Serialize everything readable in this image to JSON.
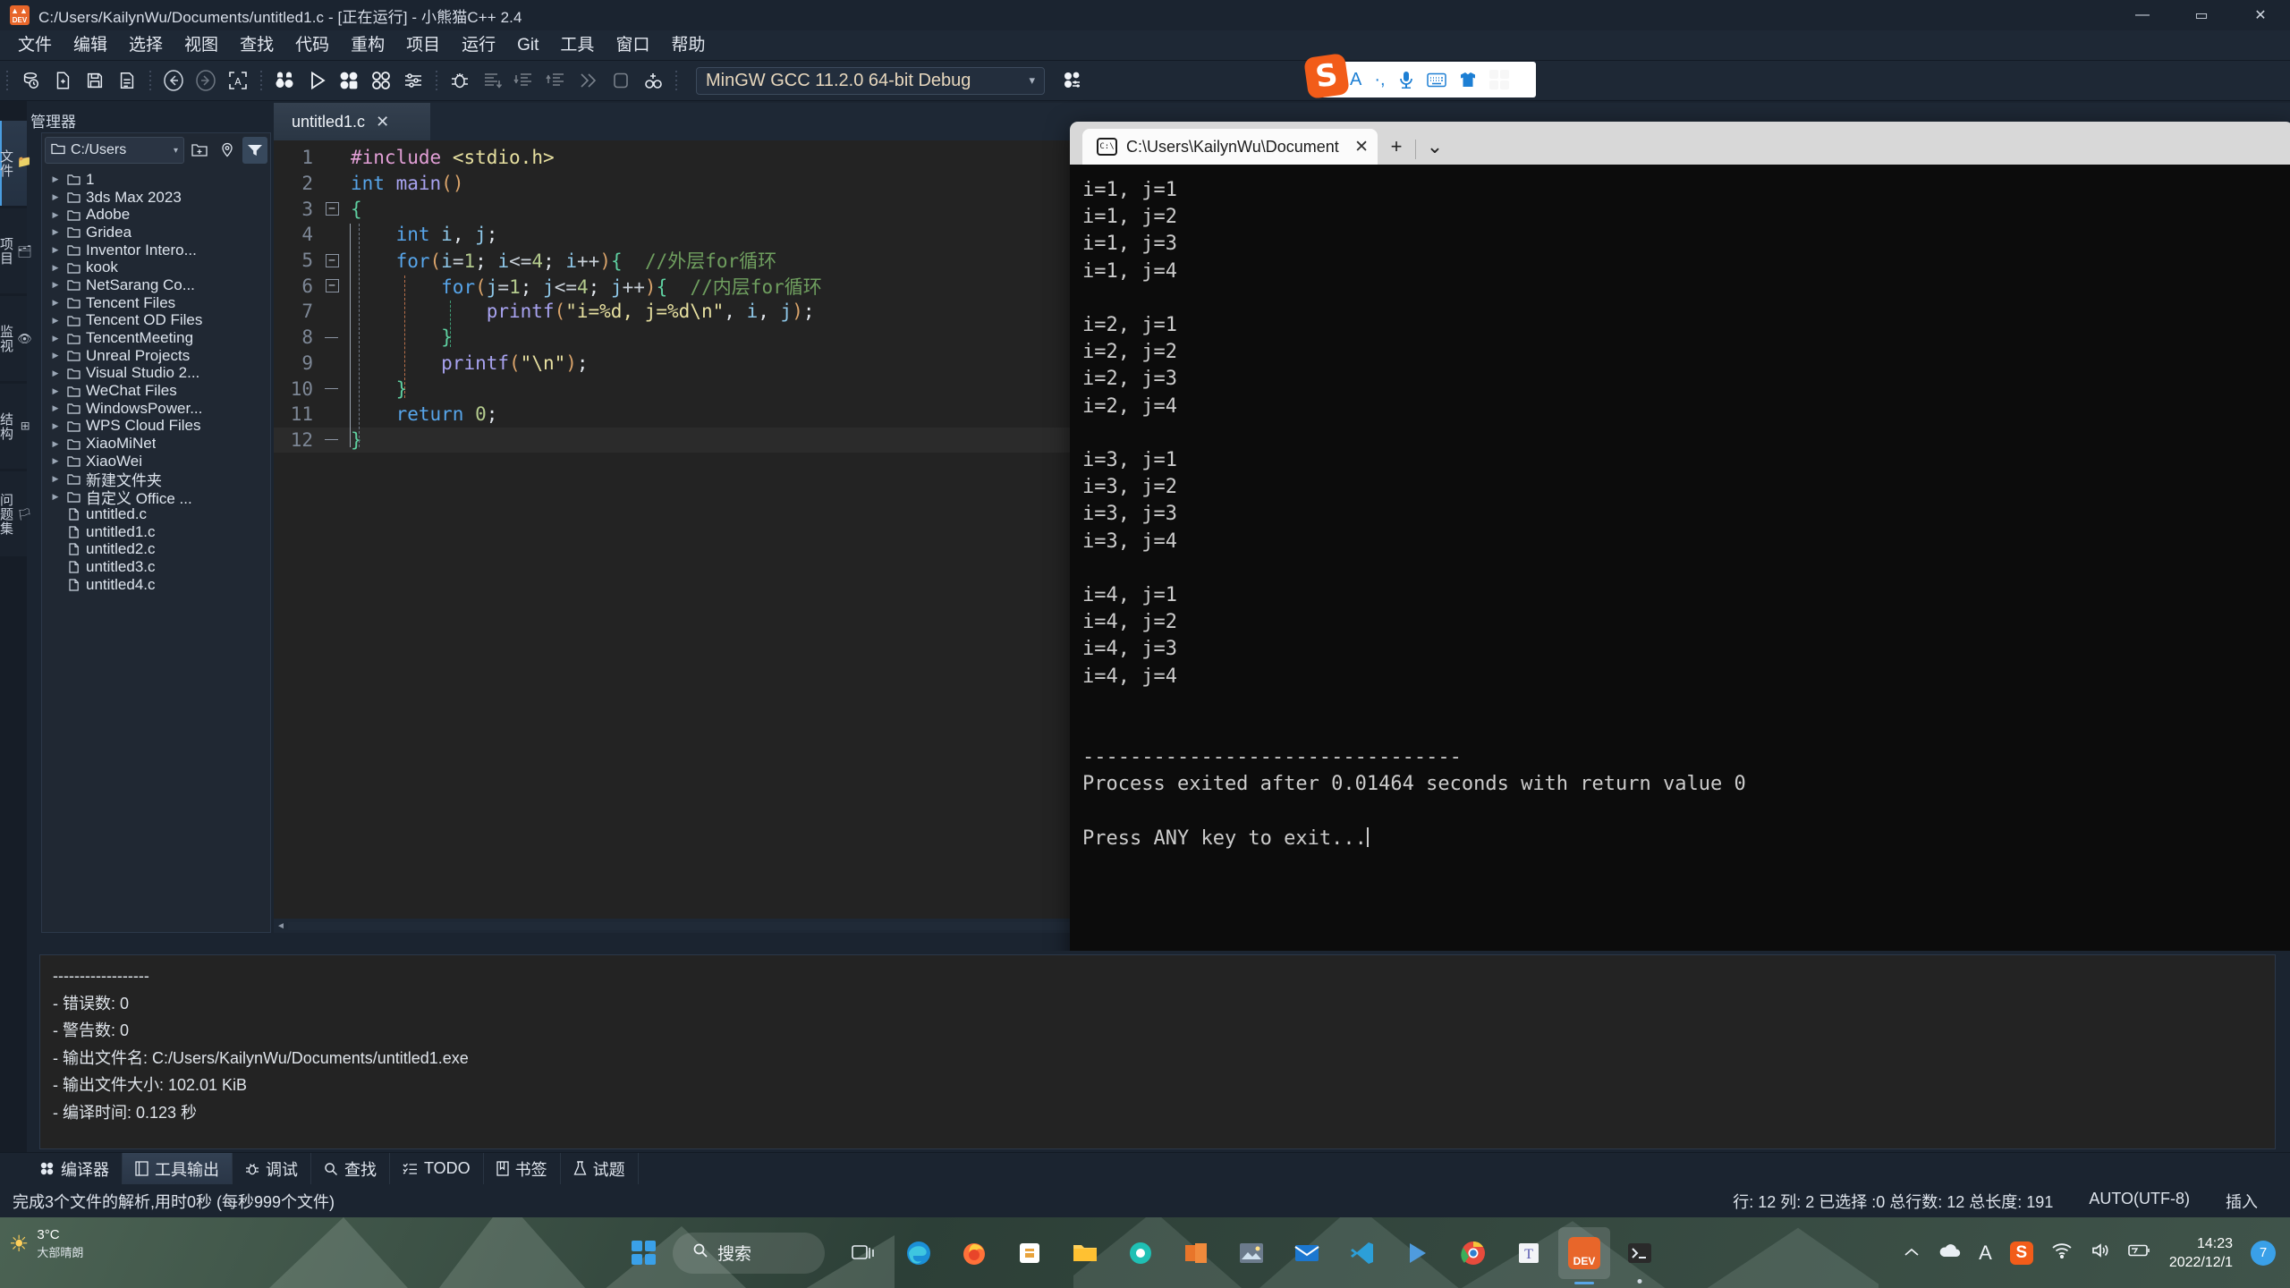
{
  "window": {
    "title": "C:/Users/KailynWu/Documents/untitled1.c - [正在运行] - 小熊猫C++ 2.4",
    "app_icon_label": "DEV",
    "minimize": "—",
    "maximize": "▭",
    "close": "✕"
  },
  "menubar": {
    "items": [
      "文件",
      "编辑",
      "选择",
      "视图",
      "查找",
      "代码",
      "重构",
      "项目",
      "运行",
      "Git",
      "工具",
      "窗口",
      "帮助"
    ]
  },
  "toolbar": {
    "compiler_set": "MinGW GCC 11.2.0 64-bit Debug",
    "caret": "▾",
    "icons": [
      "project-icon",
      "new-file-icon",
      "save-icon",
      "save-as-icon",
      "back-icon",
      "forward-icon",
      "select-all-icon",
      "compile-icon",
      "run-icon",
      "compile-run-icon",
      "rebuild-icon",
      "options-icon",
      "debug-icon",
      "step-over-icon",
      "step-into-icon",
      "step-out-icon",
      "continue-icon",
      "stop-icon",
      "add-watch-icon",
      "compiler-options-icon"
    ]
  },
  "ime": {
    "logo": "S",
    "buttons": [
      "A",
      "·,",
      "mic-icon",
      "keyboard-icon",
      "skin-icon",
      "apps-icon"
    ]
  },
  "vertical_tabs": [
    {
      "label": "文件",
      "icon": "📁",
      "active": true
    },
    {
      "label": "项目",
      "icon": "🗂",
      "active": false
    },
    {
      "label": "监视",
      "icon": "👁",
      "active": false
    },
    {
      "label": "结构",
      "icon": "⊞",
      "active": false
    },
    {
      "label": "问题集",
      "icon": "🏳",
      "active": false
    }
  ],
  "explorer": {
    "title": "管理器",
    "path": "C:/Users",
    "path_caret": "▾",
    "buttons": [
      "new-folder-icon",
      "locate-icon",
      "filter-icon"
    ],
    "tree": [
      {
        "label": "1",
        "type": "folder"
      },
      {
        "label": "3ds Max 2023",
        "type": "folder"
      },
      {
        "label": "Adobe",
        "type": "folder"
      },
      {
        "label": "Gridea",
        "type": "folder"
      },
      {
        "label": "Inventor Intero...",
        "type": "folder"
      },
      {
        "label": "kook",
        "type": "folder"
      },
      {
        "label": "NetSarang Co...",
        "type": "folder"
      },
      {
        "label": "Tencent Files",
        "type": "folder"
      },
      {
        "label": "Tencent OD Files",
        "type": "folder"
      },
      {
        "label": "TencentMeeting",
        "type": "folder"
      },
      {
        "label": "Unreal Projects",
        "type": "folder"
      },
      {
        "label": "Visual Studio 2...",
        "type": "folder"
      },
      {
        "label": "WeChat Files",
        "type": "folder"
      },
      {
        "label": "WindowsPower...",
        "type": "folder"
      },
      {
        "label": "WPS Cloud Files",
        "type": "folder"
      },
      {
        "label": "XiaoMiNet",
        "type": "folder"
      },
      {
        "label": "XiaoWei",
        "type": "folder"
      },
      {
        "label": "新建文件夹",
        "type": "folder"
      },
      {
        "label": "自定义 Office ...",
        "type": "folder"
      },
      {
        "label": "untitled.c",
        "type": "file"
      },
      {
        "label": "untitled1.c",
        "type": "file"
      },
      {
        "label": "untitled2.c",
        "type": "file"
      },
      {
        "label": "untitled3.c",
        "type": "file"
      },
      {
        "label": "untitled4.c",
        "type": "file"
      }
    ]
  },
  "editor": {
    "tab_label": "untitled1.c",
    "tab_close": "✕",
    "lines": [
      {
        "n": "1",
        "fold": "",
        "text": "#include <stdio.h>"
      },
      {
        "n": "2",
        "fold": "",
        "text": "int main()"
      },
      {
        "n": "3",
        "fold": "minus",
        "text": "{"
      },
      {
        "n": "4",
        "fold": "",
        "text": "    int i, j;"
      },
      {
        "n": "5",
        "fold": "minus",
        "text": "    for(i=1; i<=4; i++){  //外层for循环"
      },
      {
        "n": "6",
        "fold": "minus",
        "text": "        for(j=1; j<=4; j++){  //内层for循环"
      },
      {
        "n": "7",
        "fold": "",
        "text": "            printf(\"i=%d, j=%d\\n\", i, j);"
      },
      {
        "n": "8",
        "fold": "end",
        "text": "        }"
      },
      {
        "n": "9",
        "fold": "",
        "text": "        printf(\"\\n\");"
      },
      {
        "n": "10",
        "fold": "end",
        "text": "    }"
      },
      {
        "n": "11",
        "fold": "",
        "text": "    return 0;"
      },
      {
        "n": "12",
        "fold": "end",
        "text": "}"
      }
    ],
    "scroll_left": "◄",
    "scroll_right": "►"
  },
  "terminal": {
    "tab_title": "C:\\Users\\KailynWu\\Document",
    "tab_icon": "C:\\",
    "tab_close": "✕",
    "new_tab": "+",
    "dropdown": "⌄",
    "output": "i=1, j=1\ni=1, j=2\ni=1, j=3\ni=1, j=4\n\ni=2, j=1\ni=2, j=2\ni=2, j=3\ni=2, j=4\n\ni=3, j=1\ni=3, j=2\ni=3, j=3\ni=3, j=4\n\ni=4, j=1\ni=4, j=2\ni=4, j=3\ni=4, j=4\n\n\n--------------------------------\nProcess exited after 0.01464 seconds with return value 0\n\nPress ANY key to exit..."
  },
  "compiler_output": {
    "text": "------------------\n- 错误数: 0\n- 警告数: 0\n- 输出文件名: C:/Users/KailynWu/Documents/untitled1.exe\n- 输出文件大小: 102.01 KiB\n- 编译时间: 0.123 秒"
  },
  "bottom_tabs": {
    "rotated_label": "调试",
    "items": [
      {
        "label": "编译器",
        "icon": "compiler-icon",
        "active": false
      },
      {
        "label": "工具输出",
        "icon": "tool-output-icon",
        "active": true
      },
      {
        "label": "调试",
        "icon": "debug-icon",
        "active": false
      },
      {
        "label": "查找",
        "icon": "search-icon",
        "active": false
      },
      {
        "label": "TODO",
        "icon": "todo-icon",
        "active": false
      },
      {
        "label": "书签",
        "icon": "bookmark-icon",
        "active": false
      },
      {
        "label": "试题",
        "icon": "problem-icon",
        "active": false
      }
    ]
  },
  "statusbar": {
    "message": "完成3个文件的解析,用时0秒 (每秒999个文件)",
    "caret_info": "行: 12 列: 2 已选择 :0 总行数: 12 总长度: 191",
    "encoding": "AUTO(UTF-8)",
    "insert_mode": "插入"
  },
  "taskbar": {
    "weather_temp": "3°C",
    "weather_desc": "大部晴朗",
    "weather_icon": "☀",
    "search_label": "搜索",
    "search_icon": "search-icon",
    "apps": [
      "start-icon",
      "task-view-icon",
      "edge-icon",
      "firefox-icon",
      "store-icon",
      "explorer-icon",
      "chrome-alt-icon",
      "office-icon",
      "photos-icon",
      "mail-icon",
      "vscode-icon",
      "player-icon",
      "chrome-icon",
      "teams-icon",
      "devcpp-icon",
      "terminal-icon"
    ],
    "tray": [
      "chevron-up-icon",
      "onedrive-icon",
      "ime-A-icon",
      "sogou-icon",
      "wifi-icon",
      "volume-icon",
      "battery-icon"
    ],
    "time": "14:23",
    "date": "2022/12/1",
    "notification_count": "7"
  }
}
